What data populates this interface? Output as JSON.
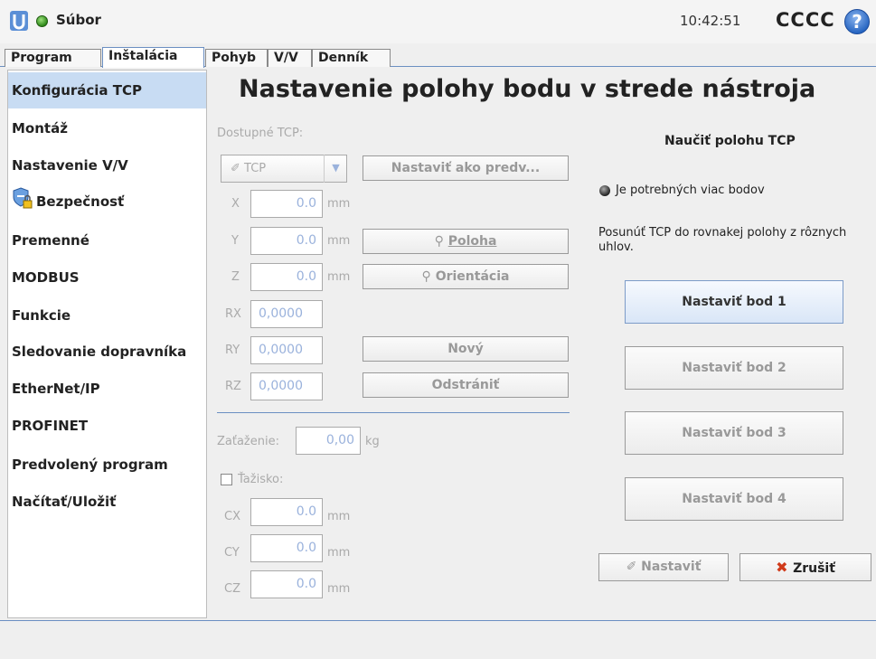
{
  "topbar": {
    "file_menu": "Súbor",
    "clock": "10:42:51",
    "robot_name": "CCCC",
    "help": "?"
  },
  "tabs": [
    "Program",
    "Inštalácia",
    "Pohyb",
    "V/V",
    "Denník"
  ],
  "sidebar": {
    "items": [
      "Konfigurácia TCP",
      "Montáž",
      "Nastavenie V/V",
      "Bezpečnosť",
      "Premenné",
      "MODBUS",
      "Funkcie",
      "Sledovanie dopravníka",
      "EtherNet/IP",
      "PROFINET",
      "Predvolený program",
      "Načítať/Uložiť"
    ]
  },
  "main": {
    "title": "Nastavenie polohy bodu v strede nástroja",
    "available_label": "Dostupné TCP:",
    "tcp_combo": "TCP",
    "set_default_btn": "Nastaviť ako predv...",
    "labels": {
      "x": "X",
      "y": "Y",
      "z": "Z",
      "rx": "RX",
      "ry": "RY",
      "rz": "RZ",
      "mm": "mm",
      "kg": "kg",
      "cx": "CX",
      "cy": "CY",
      "cz": "CZ"
    },
    "values": {
      "x": "0.0",
      "y": "0.0",
      "z": "0.0",
      "rx": "0,0000",
      "ry": "0,0000",
      "rz": "0,0000",
      "payload": "0,00",
      "cx": "0.0",
      "cy": "0.0",
      "cz": "0.0"
    },
    "position_btn": "Poloha",
    "orientation_btn": "Orientácia",
    "new_btn": "Nový",
    "remove_btn": "Odstrániť",
    "payload_label": "Zaťaženie:",
    "cog_label": "Ťažisko:"
  },
  "teach": {
    "title": "Naučiť polohu TCP",
    "warning": "Je potrebných viac bodov",
    "instruction": "Posunúť TCP do rovnakej polohy z rôznych uhlov.",
    "buttons": [
      "Nastaviť bod 1",
      "Nastaviť bod 2",
      "Nastaviť bod 3",
      "Nastaviť bod 4"
    ],
    "set_btn": "Nastaviť",
    "cancel_btn": "Zrušiť"
  }
}
